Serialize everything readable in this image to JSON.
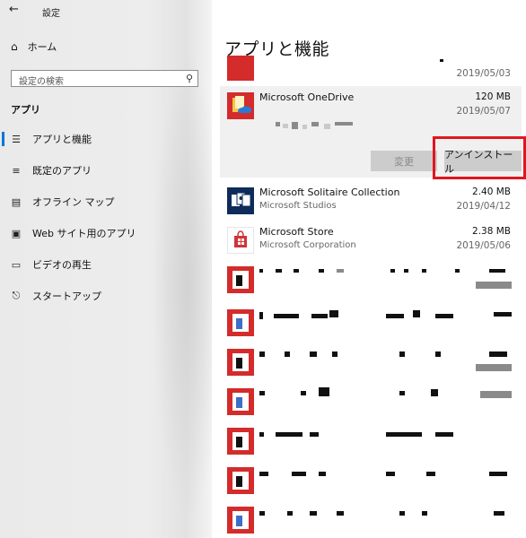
{
  "window": {
    "title": "設定"
  },
  "sidebar": {
    "home_label": "ホーム",
    "search_placeholder": "設定の検索",
    "section_title": "アプリ",
    "items": [
      {
        "label": "アプリと機能",
        "icon": "list-icon",
        "active": true
      },
      {
        "label": "既定のアプリ",
        "icon": "default-apps-icon"
      },
      {
        "label": "オフライン マップ",
        "icon": "offline-map-icon"
      },
      {
        "label": "Web サイト用のアプリ",
        "icon": "website-apps-icon"
      },
      {
        "label": "ビデオの再生",
        "icon": "video-icon"
      },
      {
        "label": "スタートアップ",
        "icon": "startup-icon"
      }
    ]
  },
  "main": {
    "title": "アプリと機能",
    "apps": [
      {
        "name": "",
        "publisher": "",
        "size": "",
        "date": "2019/05/03",
        "icon": "red-app-icon"
      },
      {
        "name": "Microsoft OneDrive",
        "publisher": "",
        "size": "120 MB",
        "date": "2019/05/07",
        "icon": "onedrive-icon",
        "selected": true
      },
      {
        "name": "Microsoft Solitaire Collection",
        "publisher": "Microsoft Studios",
        "size": "2.40 MB",
        "date": "2019/04/12",
        "icon": "solitaire-icon"
      },
      {
        "name": "Microsoft Store",
        "publisher": "Microsoft Corporation",
        "size": "2.38 MB",
        "date": "2019/05/06",
        "icon": "store-icon"
      }
    ],
    "buttons": {
      "modify": "変更",
      "uninstall": "アンインストール"
    },
    "accent_color": "#0078d4",
    "highlight_color": "#e0161f"
  }
}
